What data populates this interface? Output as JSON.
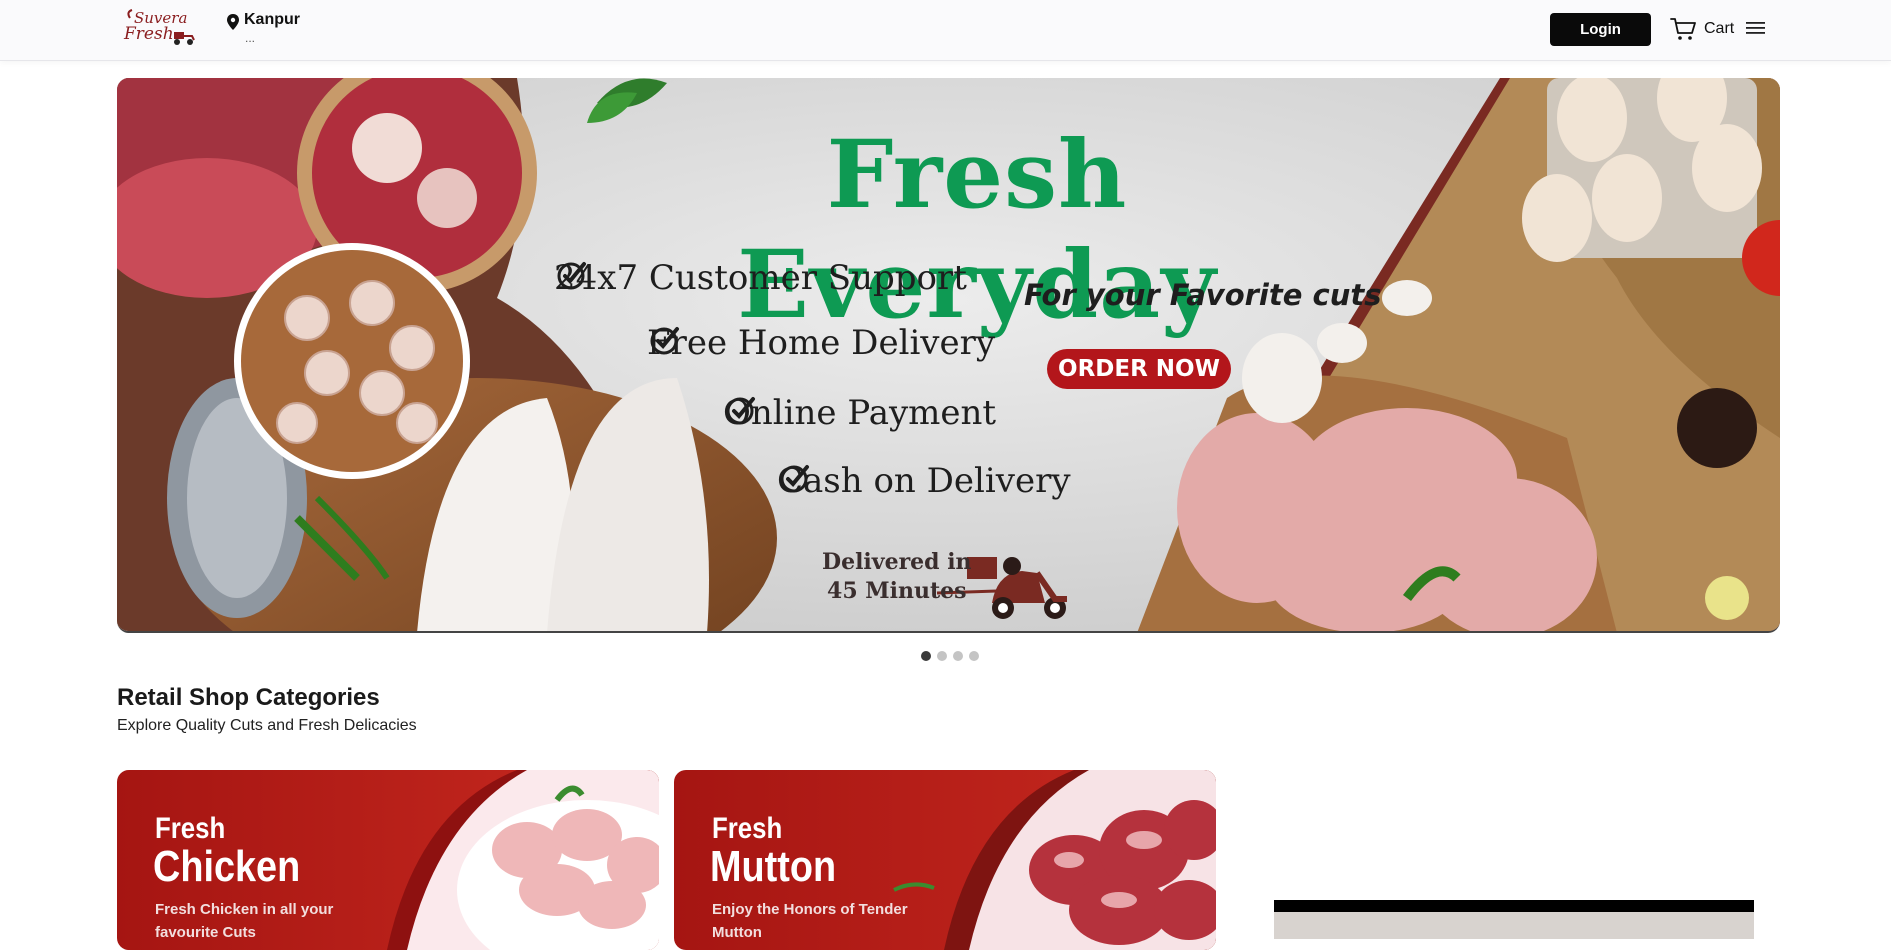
{
  "header": {
    "logo_text_1": "Suvera",
    "logo_text_2": "Fresh",
    "location_city": "Kanpur",
    "location_sub": "...",
    "login_label": "Login",
    "cart_label": "Cart"
  },
  "banner": {
    "title": "Fresh Everyday",
    "features": [
      "24x7 Customer Support",
      "Free Home Delivery",
      "Online Payment",
      "Cash on Delivery"
    ],
    "tagline": "For your Favorite cuts",
    "cta": "ORDER NOW",
    "delivery_line1": "Delivered in",
    "delivery_line2": "45 Minutes",
    "colors": {
      "title": "#0e9a53",
      "cta": "#b3161b"
    },
    "slides_total": 4,
    "active_slide": 1
  },
  "categories": {
    "title": "Retail Shop Categories",
    "subtitle": "Explore Quality Cuts and Fresh Delicacies",
    "items": [
      {
        "title_line1": "Fresh",
        "title_line2": "Chicken",
        "description": "Fresh Chicken in all your favourite Cuts"
      },
      {
        "title_line1": "Fresh",
        "title_line2": "Mutton",
        "description": "Enjoy the Honors of Tender Mutton"
      }
    ]
  }
}
